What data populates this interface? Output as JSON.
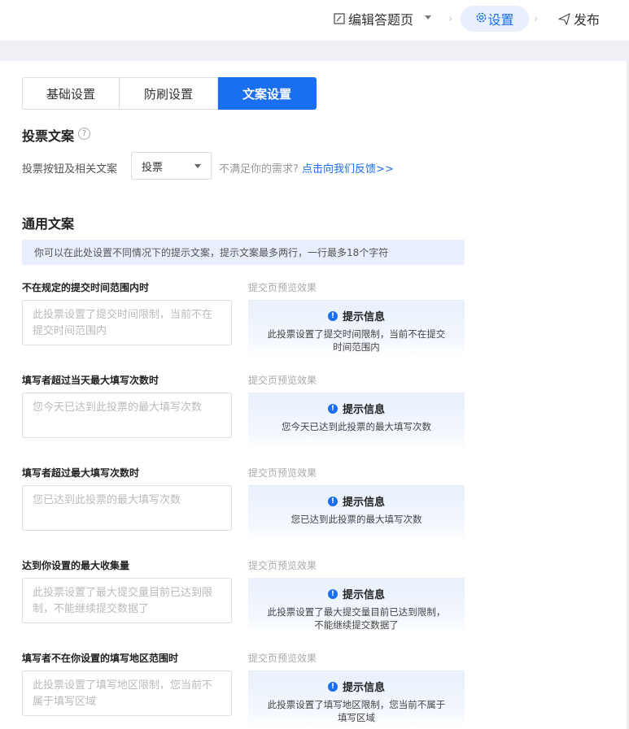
{
  "header": {
    "steps": [
      {
        "label": "编辑答题页",
        "icon": "edit-icon"
      },
      {
        "label": "设置",
        "icon": "gear-icon"
      },
      {
        "label": "发布",
        "icon": "send-icon"
      }
    ]
  },
  "tabs": [
    "基础设置",
    "防刷设置",
    "文案设置"
  ],
  "vote_section": {
    "title": "投票文案",
    "field_label": "投票按钮及相关文案",
    "select_value": "投票",
    "hint": "不满足你的需求?",
    "feedback_link": "点击向我们反馈>>"
  },
  "general_section": {
    "title": "通用文案",
    "note": "你可以在此处设置不同情况下的提示文案，提示文案最多两行，一行最多18个字符",
    "preview_label": "提交页预览效果",
    "preview_heading": "提示信息",
    "items": [
      {
        "title": "不在规定的提交时间范围内时",
        "placeholder": "此投票设置了提交时间限制，当前不在提交时间范围内",
        "preview": "此投票设置了提交时间限制，当前不在提交时间范围内"
      },
      {
        "title": "填写者超过当天最大填写次数时",
        "placeholder": "您今天已达到此投票的最大填写次数",
        "preview": "您今天已达到此投票的最大填写次数"
      },
      {
        "title": "填写者超过最大填写次数时",
        "placeholder": "您已达到此投票的最大填写次数",
        "preview": "您已达到此投票的最大填写次数"
      },
      {
        "title": "达到你设置的最大收集量",
        "placeholder": "此投票设置了最大提交量目前已达到限制，不能继续提交数据了",
        "preview": "此投票设置了最大提交量目前已达到限制，不能继续提交数据了"
      },
      {
        "title": "填写者不在你设置的填写地区范围时",
        "placeholder": "此投票设置了填写地区限制，您当前不属于填写区域",
        "preview": "此投票设置了填写地区限制，您当前不属于填写区域"
      }
    ]
  },
  "colors": {
    "accent": "#1a6ff0",
    "note_bg": "#e8eefb"
  }
}
